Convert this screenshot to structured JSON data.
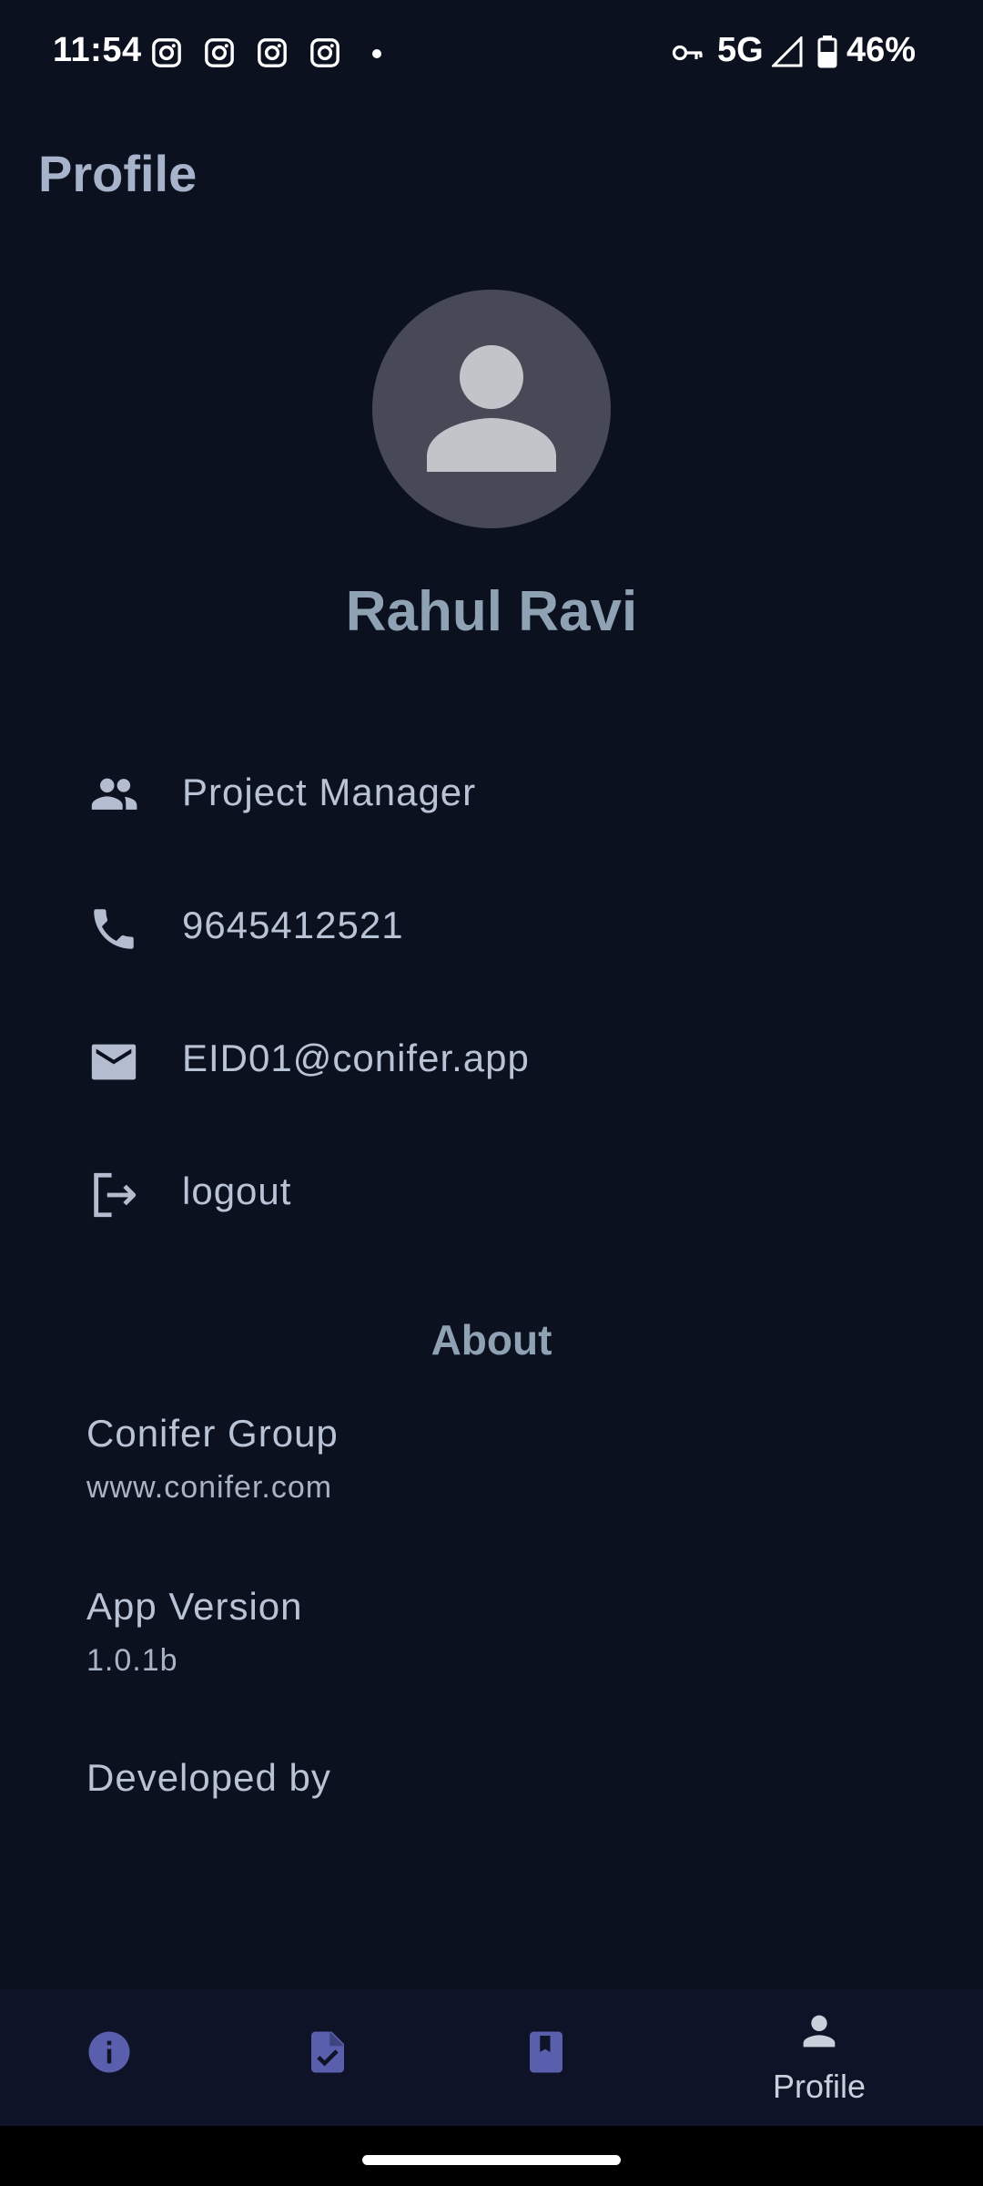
{
  "status_bar": {
    "time": "11:54",
    "network": "5G",
    "battery": "46%",
    "notification_icons": [
      "instagram-icon",
      "instagram-icon",
      "instagram-icon",
      "instagram-icon"
    ]
  },
  "header": {
    "title": "Profile"
  },
  "profile": {
    "avatar_icon": "person-icon",
    "name": "Rahul Ravi",
    "details": [
      {
        "icon": "people-icon",
        "label": "Project Manager"
      },
      {
        "icon": "phone-icon",
        "label": "9645412521"
      },
      {
        "icon": "email-icon",
        "label": "EID01@conifer.app"
      },
      {
        "icon": "logout-icon",
        "label": "logout"
      }
    ]
  },
  "about": {
    "title": "About",
    "company": "Conifer Group",
    "website": "www.conifer.com",
    "version_label": "App Version",
    "version": "1.0.1b",
    "developed_by_label": "Developed by"
  },
  "bottom_nav": {
    "items": [
      {
        "icon": "info-icon"
      },
      {
        "icon": "task-document-icon"
      },
      {
        "icon": "bookmark-book-icon"
      },
      {
        "icon": "person-icon",
        "label": "Profile",
        "active": true
      }
    ]
  },
  "colors": {
    "background": "#0c1120",
    "accent_title": "#8ea2b4",
    "nav_icon": "#5a5fad",
    "nav_background": "#0e1328"
  }
}
